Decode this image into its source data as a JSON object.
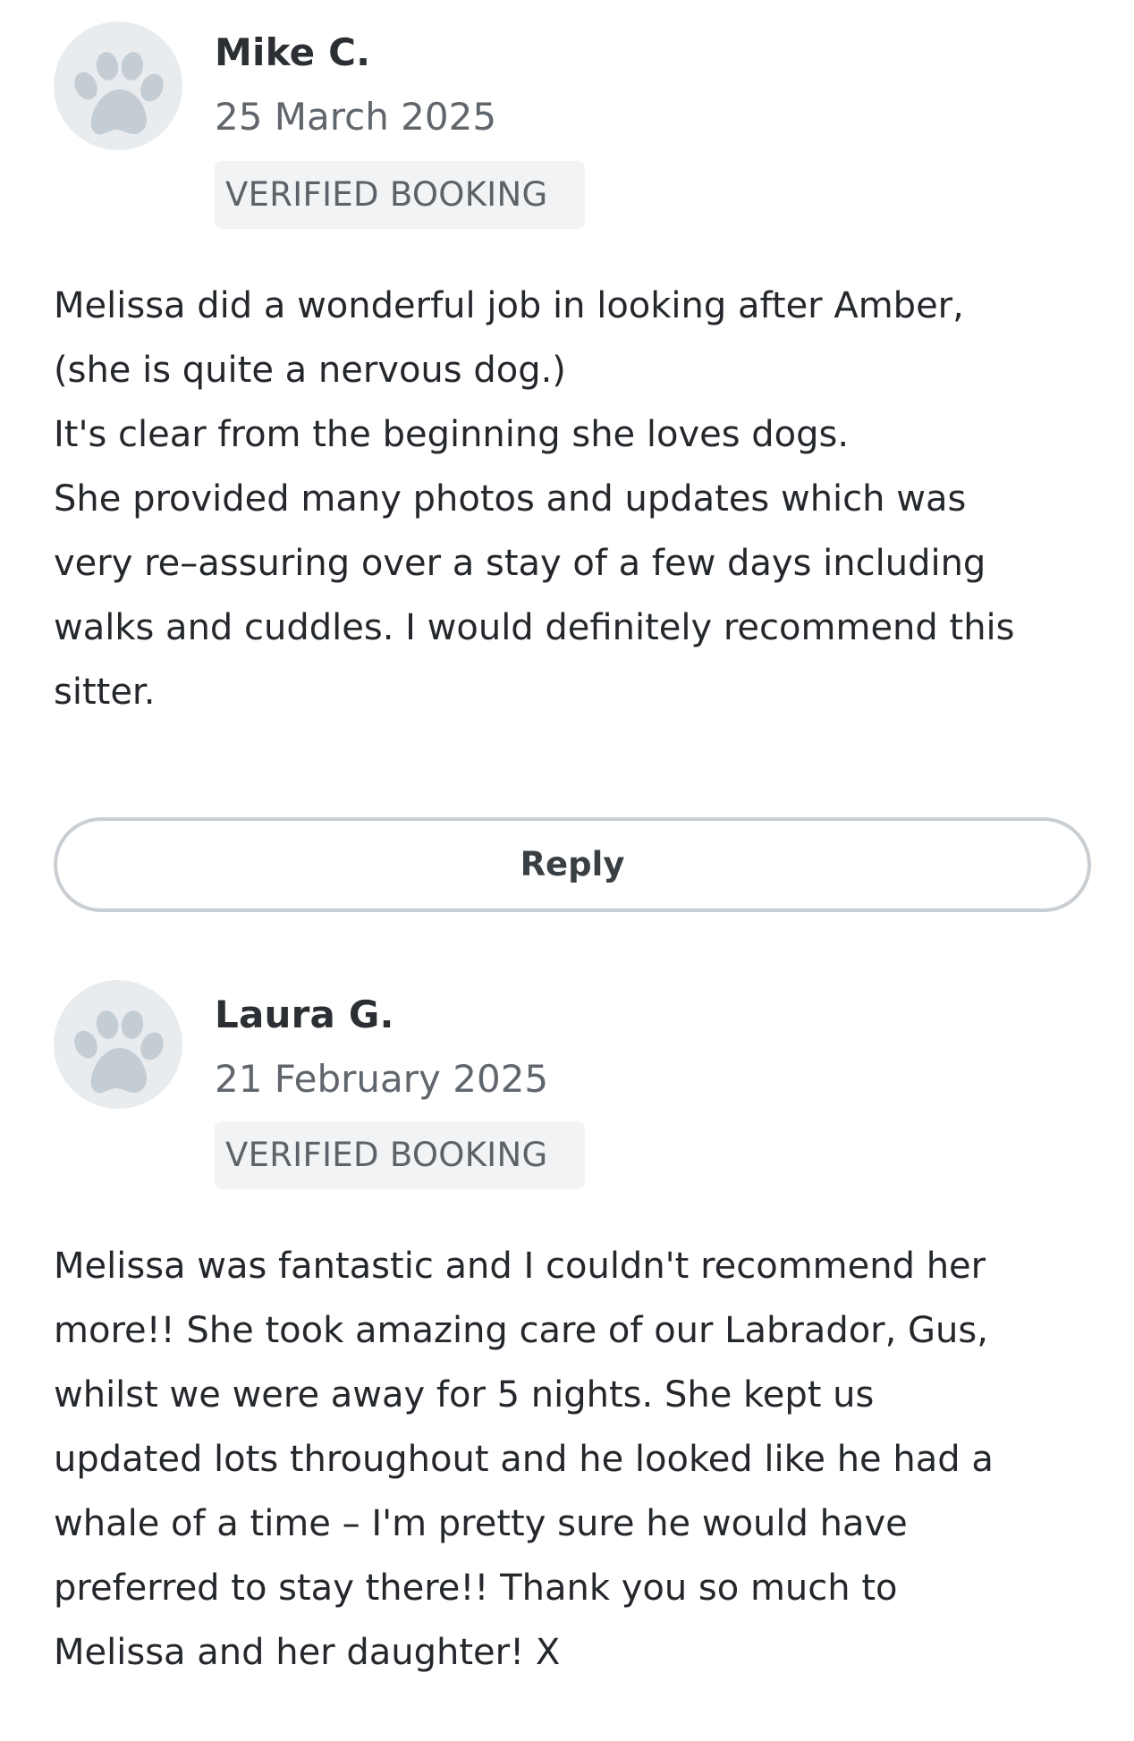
{
  "reviews": [
    {
      "avatar_icon": "paw-icon",
      "name": "Mike C.",
      "date": "25 March 2025",
      "badge": "VERIFIED BOOKING",
      "text": "Melissa did a wonderful job in looking after Amber,\n(she is quite a nervous dog.)\nIt's clear from the beginning she loves dogs.\nShe provided many photos and updates which was\nvery re–assuring over a stay of a few days including\nwalks and cuddles. I would definitely recommend this\nsitter.",
      "reply_label": "Reply"
    },
    {
      "avatar_icon": "paw-icon",
      "name": "Laura G.",
      "date": "21 February 2025",
      "badge": "VERIFIED BOOKING",
      "text": "Melissa was fantastic and I couldn't recommend her\nmore!! She took amazing care of our Labrador, Gus,\nwhilst we were away for 5 nights. She kept us\nupdated lots throughout and he looked like he had a\nwhale of a time – I'm pretty sure he would have\npreferred to stay there!! Thank you so much to\nMelissa and her daughter! X"
    }
  ],
  "colors": {
    "avatar_bg": "#e9ecef",
    "paw": "#c4ccd4",
    "badge_bg": "#f1f3f5",
    "button_border": "#c9ced3"
  }
}
